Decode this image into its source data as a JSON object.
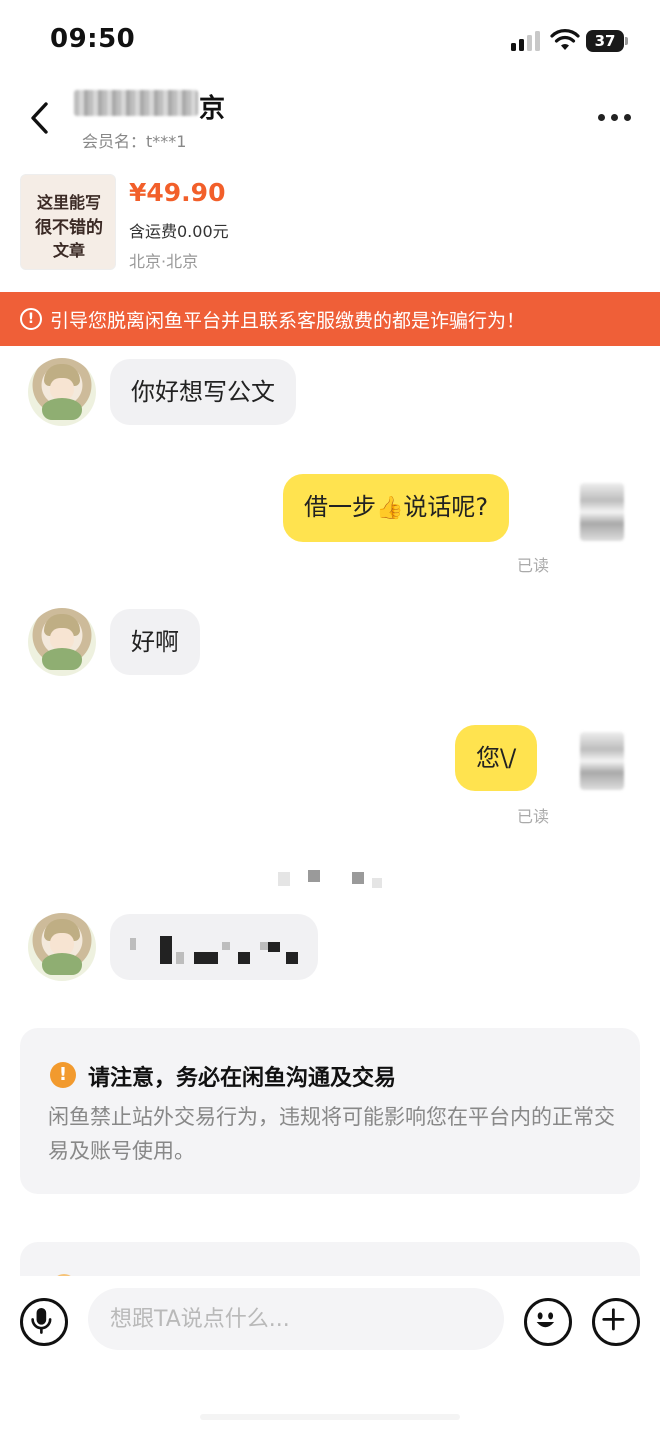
{
  "status_bar": {
    "time": "09:50",
    "battery": "37"
  },
  "header": {
    "name_suffix": "京",
    "member_label": "会员名：t***1"
  },
  "product": {
    "thumb_lines": [
      "这里能写",
      "很不错的",
      "文章"
    ],
    "price": "¥49.90",
    "shipping": "含运费0.00元",
    "location": "北京·北京"
  },
  "warning_bar": {
    "text": "引导您脱离闲鱼平台并且联系客服缴费的都是诈骗行为！"
  },
  "messages": [
    {
      "side": "in",
      "text": "你好想写公文"
    },
    {
      "side": "out",
      "text_before": "借一步",
      "emoji": "👍",
      "text_after": "说话呢?",
      "status": "已读"
    },
    {
      "side": "in",
      "text": "好啊"
    },
    {
      "side": "out",
      "text": "您\\/",
      "status": "已读"
    }
  ],
  "notice": {
    "title": "请注意，务必在闲鱼沟通及交易",
    "body": "闲鱼禁止站外交易行为，违规将可能影响您在平台内的正常交易及账号使用。"
  },
  "input_bar": {
    "placeholder": "想跟TA说点什么..."
  },
  "icons": {
    "back": "chevron-left-icon",
    "more": "more-dots-icon",
    "warning": "alert-circle-icon",
    "mic": "microphone-icon",
    "emoji": "smiley-icon",
    "plus": "plus-icon"
  },
  "colors": {
    "accent_orange": "#ef5f38",
    "price": "#f25f2a",
    "outgoing_bubble": "#ffe34f",
    "incoming_bubble": "#f1f1f3"
  }
}
